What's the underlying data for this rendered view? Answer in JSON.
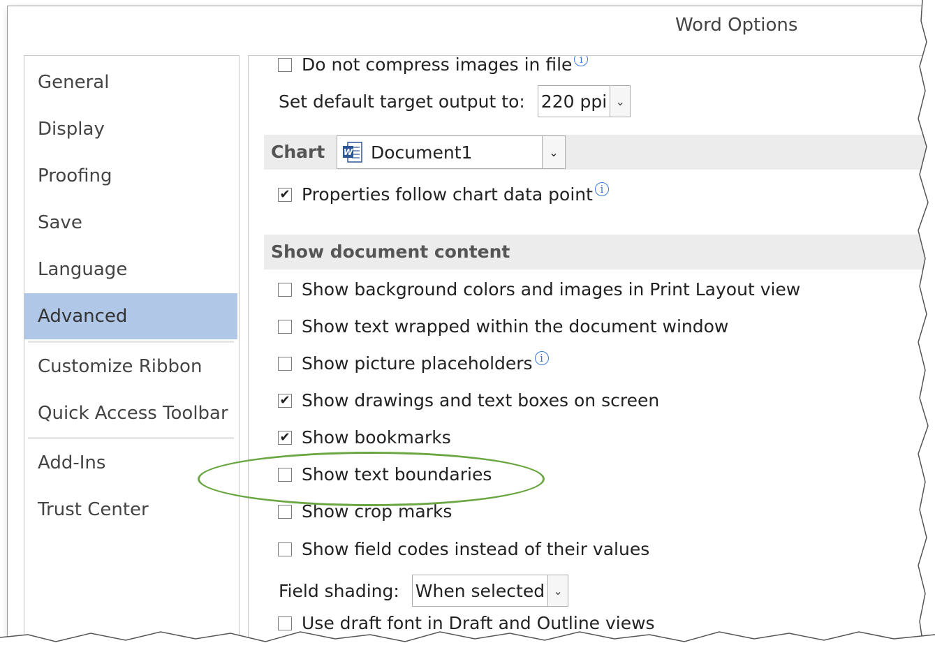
{
  "window": {
    "title": "Word Options"
  },
  "nav": {
    "items": [
      {
        "label": "General"
      },
      {
        "label": "Display"
      },
      {
        "label": "Proofing"
      },
      {
        "label": "Save"
      },
      {
        "label": "Language"
      },
      {
        "label": "Advanced",
        "active": true
      },
      {
        "label": "Customize Ribbon"
      },
      {
        "label": "Quick Access Toolbar"
      },
      {
        "label": "Add-Ins"
      },
      {
        "label": "Trust Center"
      }
    ]
  },
  "image": {
    "no_compress_label": "Do not compress images in file",
    "target_output_label": "Set default target output to:",
    "target_output_value": "220 ppi"
  },
  "chart": {
    "section_label": "Chart",
    "document_value": "Document1",
    "properties_follow_label": "Properties follow chart data point",
    "properties_follow_checked": true
  },
  "show_content": {
    "section_label": "Show document content",
    "options": [
      {
        "label": "Show background colors and images in Print Layout view",
        "checked": false
      },
      {
        "label": "Show text wrapped within the document window",
        "checked": false
      },
      {
        "label": "Show picture placeholders",
        "checked": false
      },
      {
        "label": "Show drawings and text boxes on screen",
        "checked": true
      },
      {
        "label": "Show bookmarks",
        "checked": true
      },
      {
        "label": "Show text boundaries",
        "checked": false
      },
      {
        "label": "Show crop marks",
        "checked": false
      },
      {
        "label": "Show field codes instead of their values",
        "checked": false
      }
    ],
    "field_shading_label": "Field shading:",
    "field_shading_value": "When selected",
    "draft_font_label": "Use draft font in Draft and Outline views",
    "draft_font_checked": false
  },
  "colors": {
    "active_nav": "#b0c7e8",
    "highlight_ellipse": "#6aa642",
    "info_icon": "#3a78d8"
  }
}
